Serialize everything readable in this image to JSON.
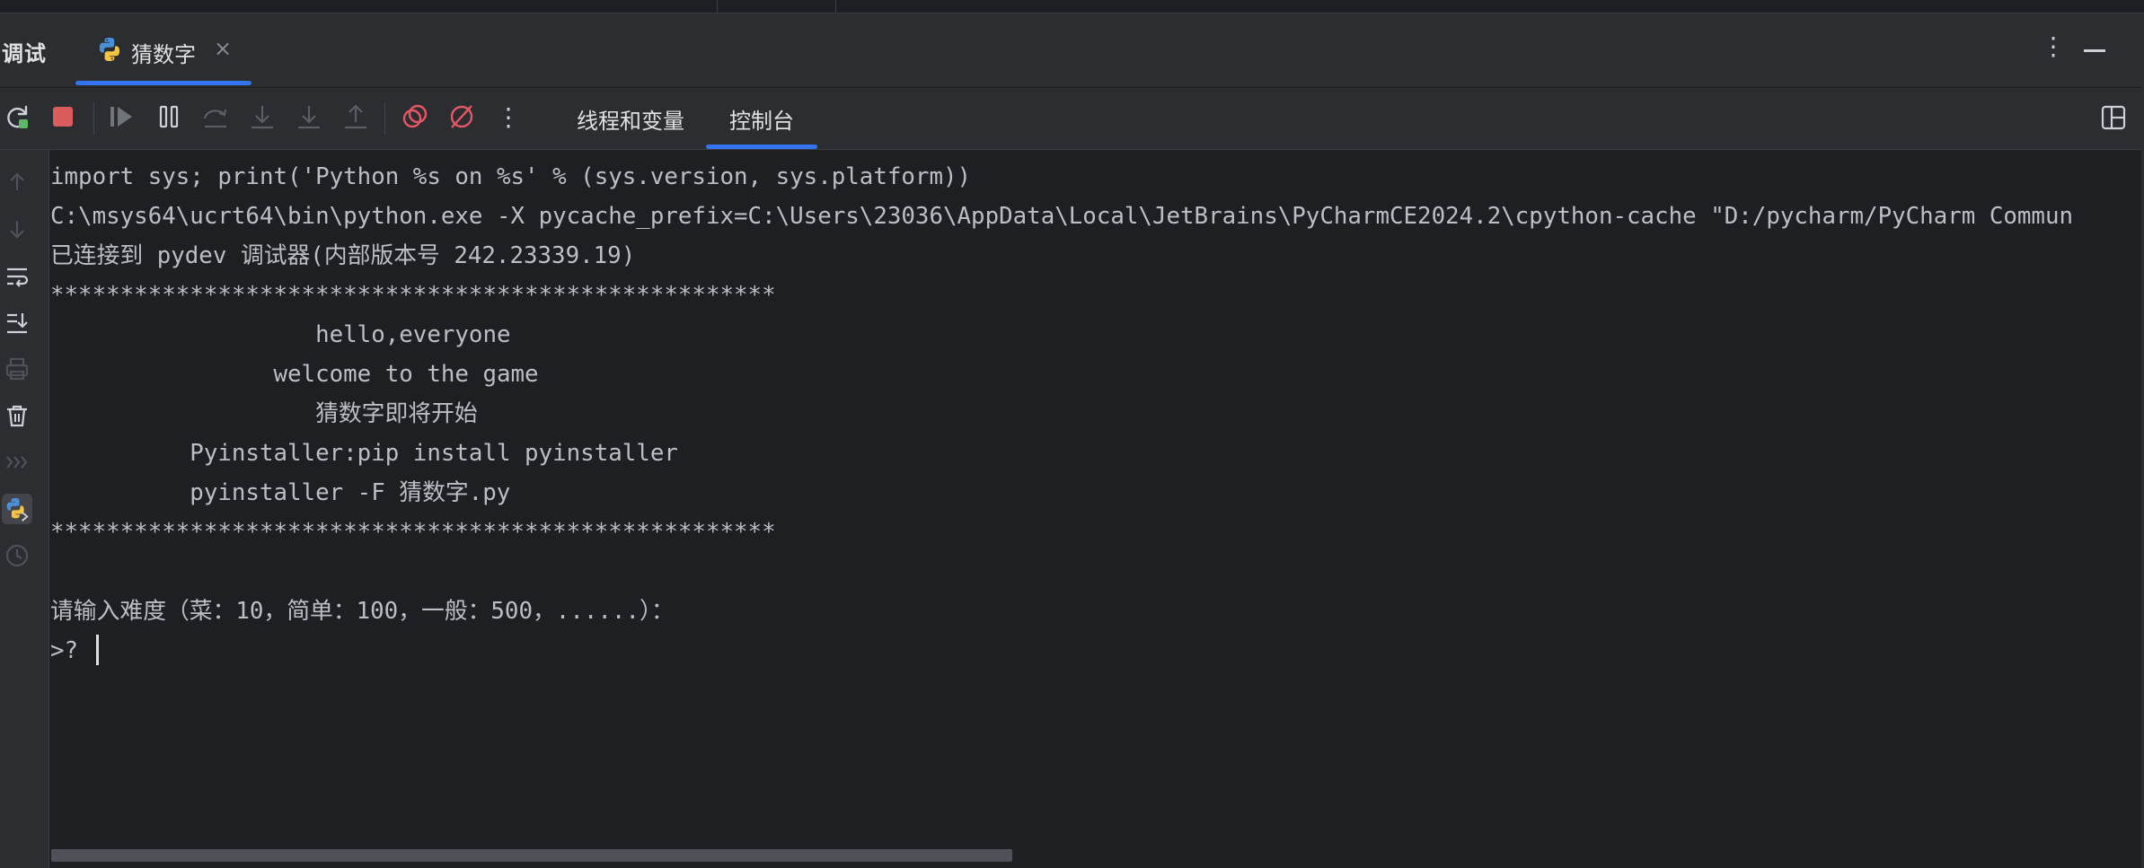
{
  "header": {
    "title": "调试",
    "tab_label": "猜数字",
    "tab_close": "×",
    "more": "⋮"
  },
  "toolbar": {
    "tabs": [
      {
        "label": "线程和变量",
        "active": false
      },
      {
        "label": "控制台",
        "active": true
      }
    ],
    "icons": [
      "rerun-icon",
      "stop-icon",
      "resume-icon",
      "pause-icon",
      "step-over-icon",
      "step-into-icon",
      "step-into-my-code-icon",
      "step-out-icon",
      "view-breakpoints-icon",
      "mute-breakpoints-icon",
      "more-icon"
    ],
    "more_label": "⋮"
  },
  "gutter": {
    "icons": [
      "up-arrow-icon",
      "down-arrow-icon",
      "soft-wrap-icon",
      "scroll-to-end-icon",
      "print-icon",
      "clear-all-icon",
      "show-command-queue-icon",
      "python-console-icon",
      "history-icon"
    ]
  },
  "console": {
    "lines": [
      "import sys; print('Python %s on %s' % (sys.version, sys.platform))",
      "C:\\msys64\\ucrt64\\bin\\python.exe -X pycache_prefix=C:\\Users\\23036\\AppData\\Local\\JetBrains\\PyCharmCE2024.2\\cpython-cache \"D:/pycharm/PyCharm Commun",
      "已连接到 pydev 调试器(内部版本号 242.23339.19)",
      "****************************************************",
      "                   hello,everyone",
      "                welcome to the game",
      "                   猜数字即将开始",
      "          Pyinstaller:pip install pyinstaller",
      "          pyinstaller -F 猜数字.py",
      "****************************************************",
      "",
      "请输入难度（菜：10，简单：100，一般：500，......）：",
      ">? "
    ]
  },
  "colors": {
    "background": "#1e1f22",
    "panel": "#2b2d30",
    "accent": "#3574f0",
    "stop_red": "#db5c5c",
    "breakpoint_red": "#e55765"
  }
}
